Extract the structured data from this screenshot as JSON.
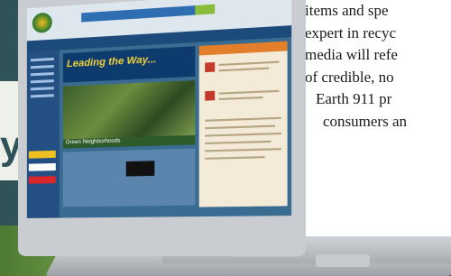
{
  "article": {
    "lines": [
      "items and spe",
      "expert in recyc",
      "media will refe",
      "of credible, no",
      "Earth 911 pr",
      "consumers an"
    ]
  },
  "left_panel": {
    "letter": "y"
  },
  "laptop_screen": {
    "hero_text": "Leading the Way...",
    "caption": "Green Neighborhoods"
  },
  "colors": {
    "panel": "#2f5358",
    "site_blue": "#3a6b91",
    "accent_orange": "#e37f2a"
  }
}
